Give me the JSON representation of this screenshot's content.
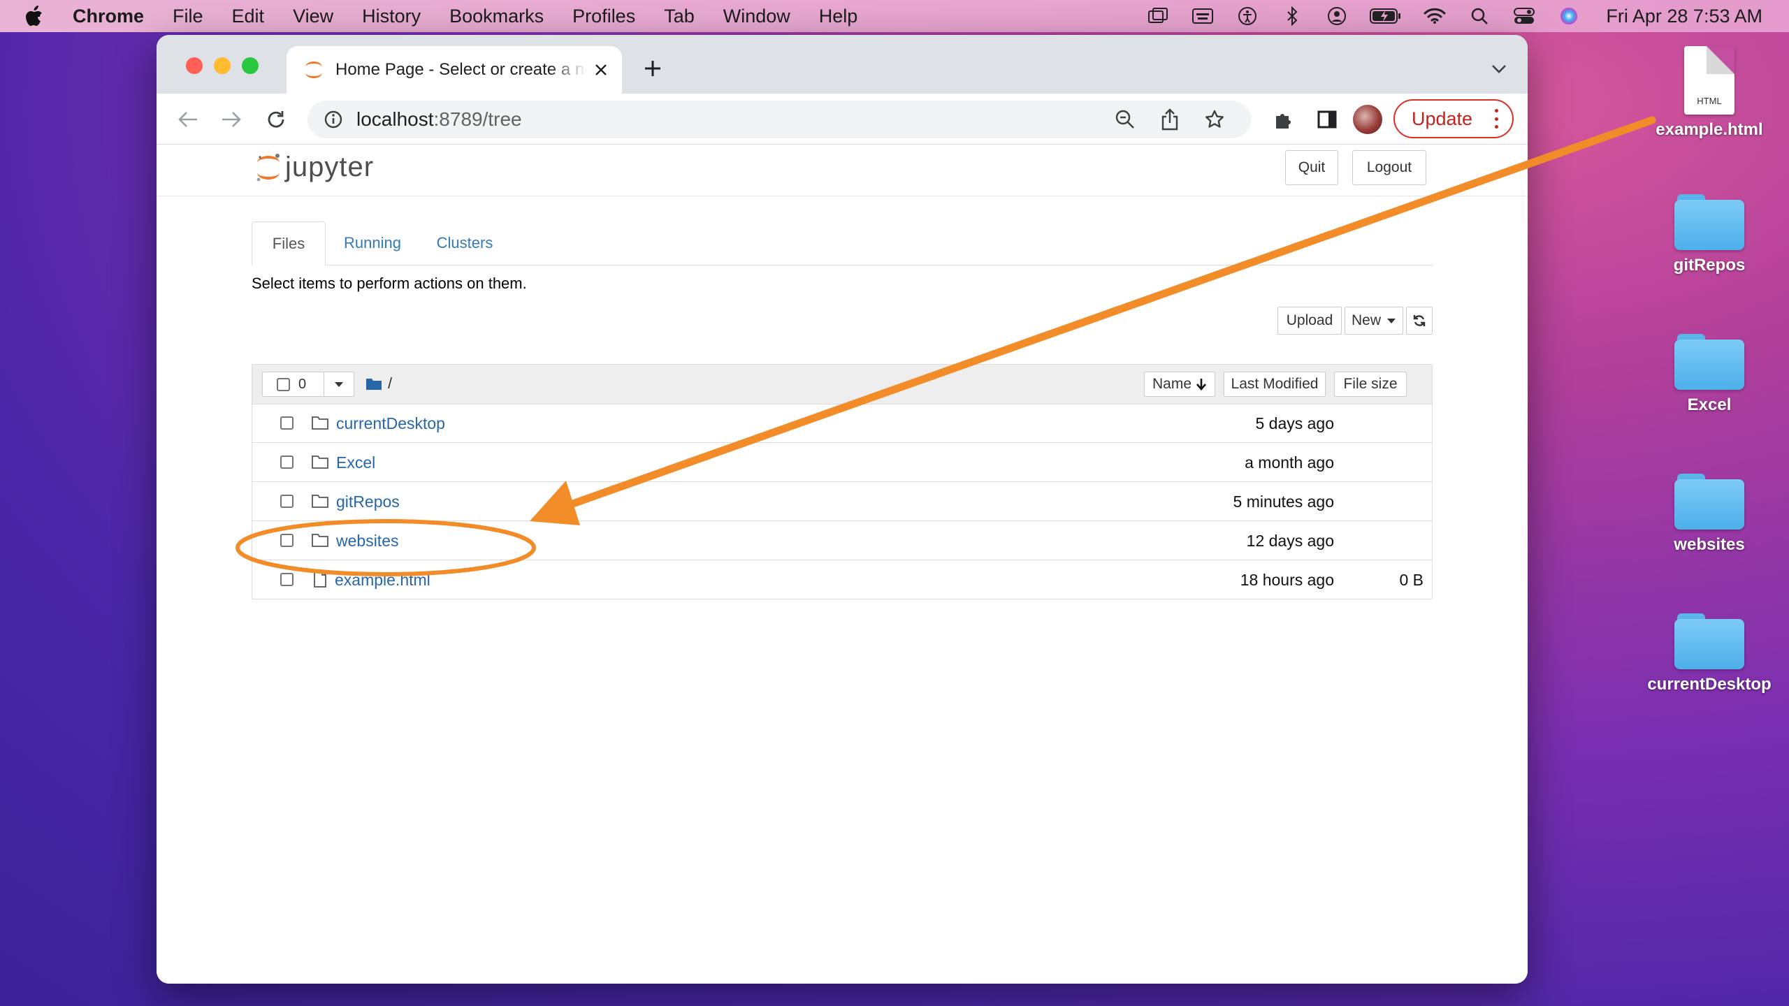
{
  "menubar": {
    "app_name": "Chrome",
    "menus": [
      "File",
      "Edit",
      "View",
      "History",
      "Bookmarks",
      "Profiles",
      "Tab",
      "Window",
      "Help"
    ],
    "clock": "Fri Apr 28  7:53 AM"
  },
  "desktop": {
    "items": [
      {
        "label": "example.html",
        "kind": "file",
        "file_type": "HTML"
      },
      {
        "label": "gitRepos",
        "kind": "folder"
      },
      {
        "label": "Excel",
        "kind": "folder"
      },
      {
        "label": "websites",
        "kind": "folder"
      },
      {
        "label": "currentDesktop",
        "kind": "folder"
      }
    ]
  },
  "browser": {
    "tab_title": "Home Page - Select or create a notebook",
    "url_host": "localhost",
    "url_path": ":8789/tree",
    "update_label": "Update"
  },
  "jupyter": {
    "logo_text": "jupyter",
    "quit_label": "Quit",
    "logout_label": "Logout",
    "tabs": [
      "Files",
      "Running",
      "Clusters"
    ],
    "hint": "Select items to perform actions on them.",
    "upload_label": "Upload",
    "new_label": "New",
    "selected_count": "0",
    "breadcrumb": "/",
    "columns": {
      "name": "Name",
      "modified": "Last Modified",
      "size": "File size"
    },
    "rows": [
      {
        "name": "currentDesktop",
        "type": "folder",
        "modified": "5 days ago",
        "size": ""
      },
      {
        "name": "Excel",
        "type": "folder",
        "modified": "a month ago",
        "size": ""
      },
      {
        "name": "gitRepos",
        "type": "folder",
        "modified": "5 minutes ago",
        "size": ""
      },
      {
        "name": "websites",
        "type": "folder",
        "modified": "12 days ago",
        "size": ""
      },
      {
        "name": "example.html",
        "type": "file",
        "modified": "18 hours ago",
        "size": "0 B"
      }
    ]
  },
  "colors": {
    "accent_orange": "#f28c28",
    "link_blue": "#2767a8",
    "update_red": "#c5221f"
  }
}
